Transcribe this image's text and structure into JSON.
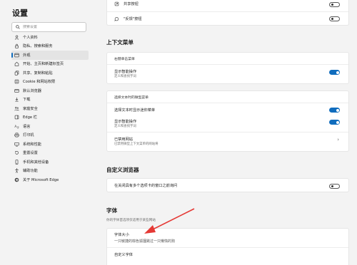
{
  "sidebar": {
    "title": "设置",
    "search_placeholder": "搜索设置",
    "items": [
      {
        "label": "个人资料",
        "icon": "person-icon"
      },
      {
        "label": "隐私、搜索和服务",
        "icon": "lock-icon"
      },
      {
        "label": "外观",
        "icon": "appearance-icon",
        "active": true
      },
      {
        "label": "开始、主页和新建标签页",
        "icon": "home-icon"
      },
      {
        "label": "共享、复制和粘贴",
        "icon": "share-icon"
      },
      {
        "label": "Cookie 和网站权限",
        "icon": "cookie-icon"
      },
      {
        "label": "默认浏览器",
        "icon": "browser-icon"
      },
      {
        "label": "下载",
        "icon": "download-icon"
      },
      {
        "label": "家庭安全",
        "icon": "family-icon"
      },
      {
        "label": "Edge 栏",
        "icon": "edge-bar-icon"
      },
      {
        "label": "语言",
        "icon": "language-icon"
      },
      {
        "label": "打印机",
        "icon": "printer-icon"
      },
      {
        "label": "系统和性能",
        "icon": "system-icon"
      },
      {
        "label": "重置设置",
        "icon": "reset-icon"
      },
      {
        "label": "手机和其他设备",
        "icon": "phone-icon"
      },
      {
        "label": "辅助功能",
        "icon": "accessibility-icon"
      },
      {
        "label": "关于 Microsoft Edge",
        "icon": "edge-logo-icon"
      }
    ]
  },
  "top_card": {
    "share_label": "共享按钮",
    "share_enabled": false,
    "feedback_label": "\"反馈\"按钮",
    "feedback_enabled": false
  },
  "context_menu": {
    "title": "上下文菜单",
    "right_click": {
      "heading": "右键单击菜单",
      "smart_actions_label": "显示智能操作",
      "smart_actions_desc": "定义和查找字词",
      "smart_actions_enabled": true
    },
    "text_select": {
      "heading": "选择文本时的微型菜单",
      "mini_menu_label": "选择文本时显示迷你菜单",
      "mini_menu_enabled": true,
      "smart_actions_label": "显示智能操作",
      "smart_actions_desc": "定义和查找字词",
      "smart_actions_enabled": true,
      "disabled_sites_label": "已禁用网站",
      "disabled_sites_desc": "已禁用微型上下文菜单的网站将"
    }
  },
  "customize_browser": {
    "title": "自定义浏览器",
    "close_tabs_label": "在关闭具有多个选项卡的窗口之前询问",
    "close_tabs_enabled": false
  },
  "fonts": {
    "title": "字体",
    "desc": "你的字体首选项仅适用于某些网站",
    "font_size_label": "字体大小",
    "font_size_preview": "一只敏捷的棕色狐狸跳过一只懒惰的狗",
    "custom_fonts_label": "自定义字体"
  },
  "colors": {
    "accent": "#0f6cbd",
    "annotation_arrow": "#e53935"
  }
}
